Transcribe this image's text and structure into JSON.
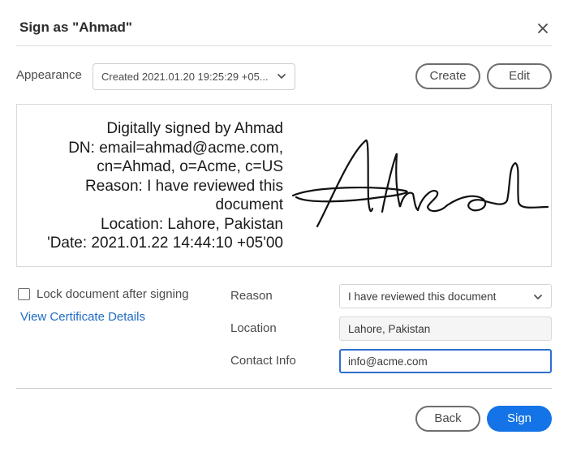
{
  "dialog": {
    "title": "Sign as \"Ahmad\"",
    "close_icon": "close-icon"
  },
  "appearance": {
    "label": "Appearance",
    "selected": "Created 2021.01.20 19:25:29 +05...",
    "create_label": "Create",
    "edit_label": "Edit"
  },
  "signature_preview": {
    "lines": [
      "Digitally signed by Ahmad",
      "DN: email=ahmad@acme.com,",
      "cn=Ahmad, o=Acme, c=US",
      "Reason: I have reviewed this",
      "document",
      "Location: Lahore, Pakistan",
      "'Date: 2021.01.22 14:44:10 +05'00"
    ],
    "handwritten_name": "Ahmad"
  },
  "options": {
    "lock_label": "Lock document after signing",
    "lock_checked": false,
    "certificate_link": "View Certificate Details"
  },
  "fields": {
    "reason_label": "Reason",
    "reason_value": "I have reviewed this document",
    "location_label": "Location",
    "location_value": "Lahore, Pakistan",
    "contact_label": "Contact Info",
    "contact_value": "info@acme.com"
  },
  "footer": {
    "back_label": "Back",
    "sign_label": "Sign"
  },
  "colors": {
    "accent": "#1473e6",
    "link": "#1f6bc4",
    "focus_border": "#2d6fce"
  }
}
